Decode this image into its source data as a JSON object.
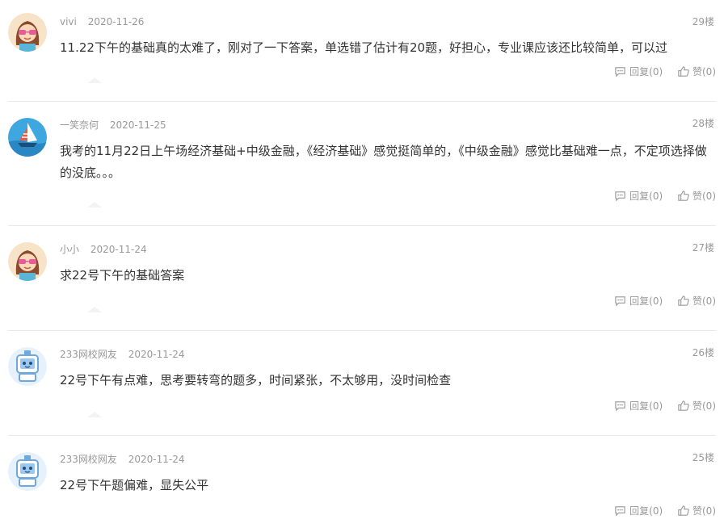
{
  "comments": [
    {
      "user": "vivi",
      "date": "2020-11-26",
      "floor": "29楼",
      "text": "11.22下午的基础真的太难了，刚对了一下答案，单选错了估计有20题，好担心，专业课应该还比较简单，可以过",
      "reply": "回复(0)",
      "like": "赞(0)",
      "avatar": "girl-avatar"
    },
    {
      "user": "一笑奈何",
      "date": "2020-11-25",
      "floor": "28楼",
      "text": "我考的11月22日上午场经济基础+中级金融，《经济基础》感觉挺简单的，《中级金融》感觉比基础难一点，不定项选择做的没底。。。",
      "reply": "回复(0)",
      "like": "赞(0)",
      "avatar": "sailboat-avatar"
    },
    {
      "user": "小小",
      "date": "2020-11-24",
      "floor": "27楼",
      "text": "求22号下午的基础答案",
      "reply": "回复(0)",
      "like": "赞(0)",
      "avatar": "girl-avatar"
    },
    {
      "user": "233网校网友",
      "date": "2020-11-24",
      "floor": "26楼",
      "text": "22号下午有点难，思考要转弯的题多，时间紧张，不太够用，没时间检查",
      "reply": "回复(0)",
      "like": "赞(0)",
      "avatar": "robot-avatar"
    },
    {
      "user": "233网校网友",
      "date": "2020-11-24",
      "floor": "25楼",
      "text": "22号下午题偏难，显失公平",
      "reply": "回复(0)",
      "like": "赞(0)",
      "avatar": "robot-avatar"
    }
  ]
}
